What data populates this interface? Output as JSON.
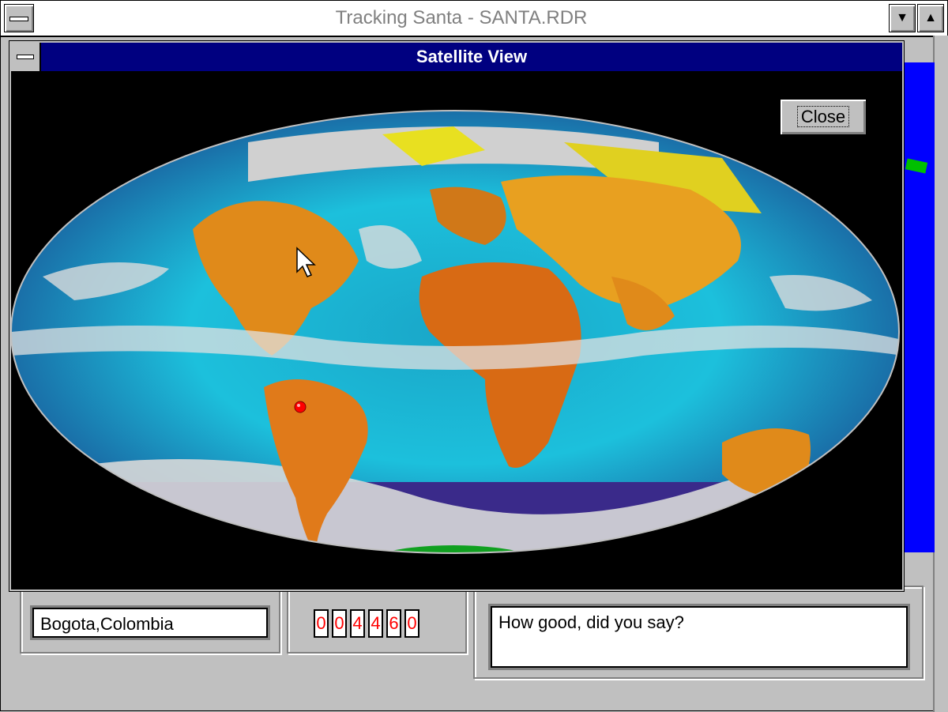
{
  "app": {
    "title": "Tracking Santa - SANTA.RDR"
  },
  "dialog": {
    "title": "Satellite View",
    "close_label": "Close"
  },
  "map": {
    "projection": "Mollweide satellite composite",
    "marker_color": "#ff0000",
    "marker_location": "Bogota,Colombia"
  },
  "panels": {
    "location_value": "Bogota,Colombia",
    "odometer_digits": [
      "0",
      "0",
      "4",
      "4",
      "6",
      "0"
    ],
    "message_value": "How good, did you say?"
  },
  "colors": {
    "dialog_titlebar": "#000080",
    "odometer_digit": "#ff0000",
    "window_face": "#c0c0c0"
  }
}
